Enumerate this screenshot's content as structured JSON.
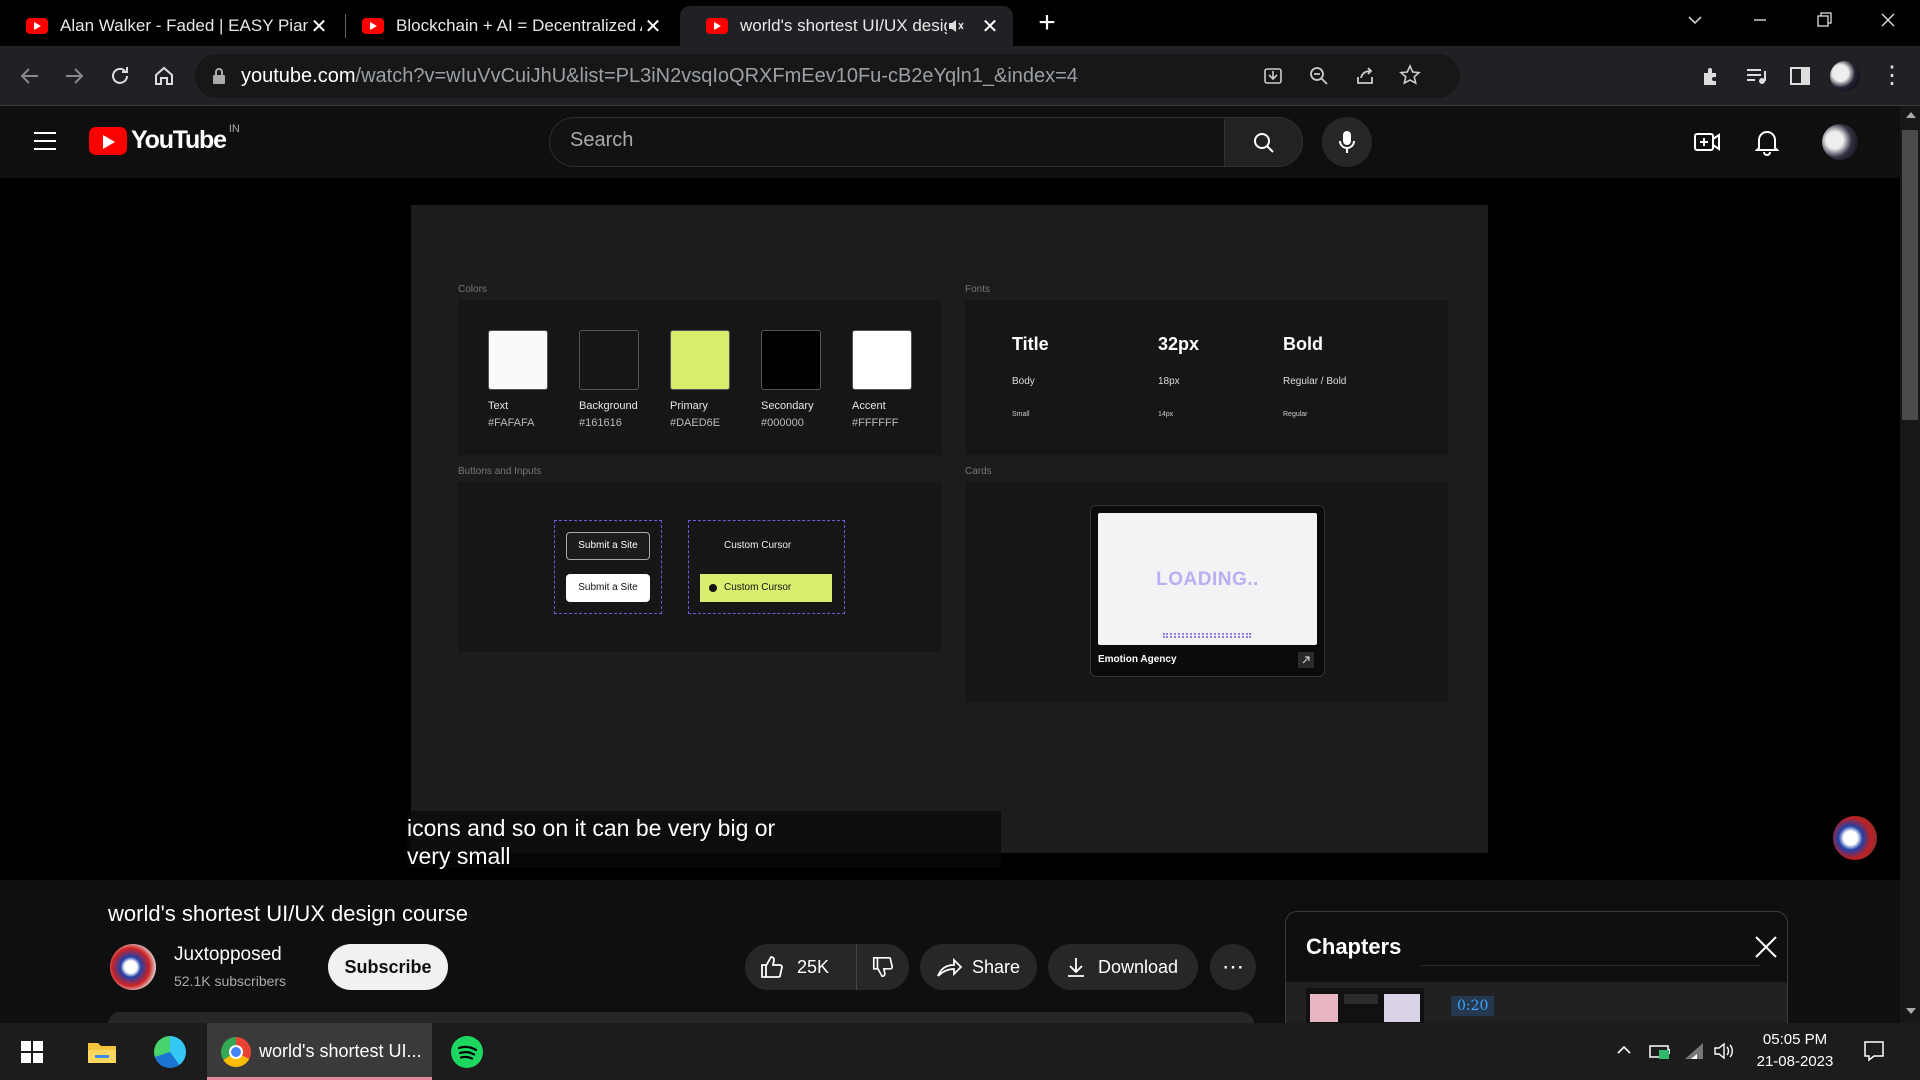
{
  "browser": {
    "tabs": [
      {
        "title": "Alan Walker - Faded | EASY Piano"
      },
      {
        "title": "Blockchain + AI = Decentralized AI"
      },
      {
        "title": "world's shortest UI/UX design course"
      }
    ],
    "url_domain": "youtube.com",
    "url_path": "/watch?v=wIuVvCuiJhU&list=PL3iN2vsqIoQRXFmEev10Fu-cB2eYqln1_&index=4"
  },
  "youtube": {
    "logo_text": "YouTube",
    "region": "IN",
    "search_placeholder": "Search"
  },
  "video": {
    "sections": {
      "colors": "Colors",
      "fonts": "Fonts",
      "buttons": "Buttons and Inputs",
      "cards": "Cards"
    },
    "swatches": [
      {
        "name": "Text",
        "hex": "#FAFAFA",
        "color": "#FAFAFA"
      },
      {
        "name": "Background",
        "hex": "#161616",
        "color": "#161616"
      },
      {
        "name": "Primary",
        "hex": "#DAED6E",
        "color": "#DAED6E"
      },
      {
        "name": "Secondary",
        "hex": "#000000",
        "color": "#000000"
      },
      {
        "name": "Accent",
        "hex": "#FFFFFF",
        "color": "#FFFFFF"
      }
    ],
    "fonts": {
      "r1": [
        "Title",
        "32px",
        "Bold"
      ],
      "r2": [
        "Body",
        "18px",
        "Regular / Bold"
      ],
      "r3": [
        "Small",
        "14px",
        "Regular"
      ]
    },
    "buttons": {
      "submit_dark": "Submit a Site",
      "submit_light": "Submit a Site",
      "cursor_plain": "Custom Cursor",
      "cursor_active": "Custom Cursor"
    },
    "card": {
      "loading": "LOADING..",
      "name": "Emotion Agency"
    },
    "caption_line1": "icons and so on it can be very big or",
    "caption_line2": "very small"
  },
  "meta": {
    "title": "world's shortest UI/UX design course",
    "channel": "Juxtopposed",
    "subscribers": "52.1K subscribers",
    "subscribe": "Subscribe",
    "likes": "25K",
    "share": "Share",
    "download": "Download"
  },
  "chapters": {
    "title": "Chapters",
    "first_time": "0:20"
  },
  "taskbar": {
    "chrome_label": "world's shortest UI...",
    "time": "05:05 PM",
    "date": "21-08-2023"
  }
}
